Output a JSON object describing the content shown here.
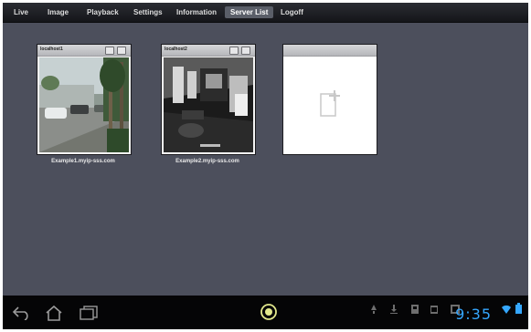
{
  "menu": {
    "items": [
      "Live",
      "Image",
      "Playback",
      "Settings",
      "Information",
      "Server List",
      "Logoff"
    ],
    "active": "Server List"
  },
  "servers": [
    {
      "title": "localhost1",
      "label": "Example1.myip-sss.com"
    },
    {
      "title": "localhost2",
      "label": "Example2.myip-sss.com"
    }
  ],
  "add_tile": {
    "icon": "add-file-icon"
  },
  "status": {
    "time": "9:35"
  },
  "colors": {
    "accent": "#35a7ff",
    "background": "#4c4f5c",
    "menubar": "#1d1e23"
  }
}
